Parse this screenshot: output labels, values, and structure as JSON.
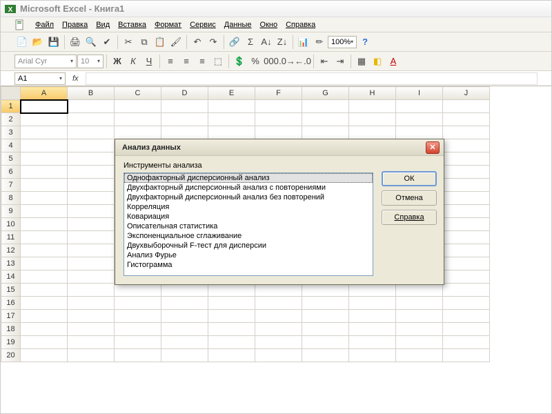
{
  "titlebar": {
    "text": "Microsoft Excel - Книга1"
  },
  "menu": {
    "items": [
      "Файл",
      "Правка",
      "Вид",
      "Вставка",
      "Формат",
      "Сервис",
      "Данные",
      "Окно",
      "Справка"
    ]
  },
  "toolbar1": {
    "zoom": "100%"
  },
  "toolbar2": {
    "font": "Arial Cyr",
    "size": "10",
    "bold": "Ж",
    "italic": "К",
    "underline": "Ч"
  },
  "formulabar": {
    "name_box": "A1",
    "fx": "fx"
  },
  "grid": {
    "columns": [
      "A",
      "B",
      "C",
      "D",
      "E",
      "F",
      "G",
      "H",
      "I",
      "J"
    ],
    "rows": [
      "1",
      "2",
      "3",
      "4",
      "5",
      "6",
      "7",
      "8",
      "9",
      "10",
      "11",
      "12",
      "13",
      "14",
      "15",
      "16",
      "17",
      "18",
      "19",
      "20"
    ],
    "active_cell": "A1"
  },
  "dialog": {
    "title": "Анализ данных",
    "list_label": "Инструменты анализа",
    "items": [
      "Однофакторный дисперсионный анализ",
      "Двухфакторный дисперсионный анализ с повторениями",
      "Двухфакторный дисперсионный анализ без повторений",
      "Корреляция",
      "Ковариация",
      "Описательная статистика",
      "Экспоненциальное сглаживание",
      "Двухвыборочный F-тест для дисперсии",
      "Анализ Фурье",
      "Гистограмма"
    ],
    "selected_index": 0,
    "buttons": {
      "ok": "ОК",
      "cancel": "Отмена",
      "help": "Справка"
    }
  }
}
